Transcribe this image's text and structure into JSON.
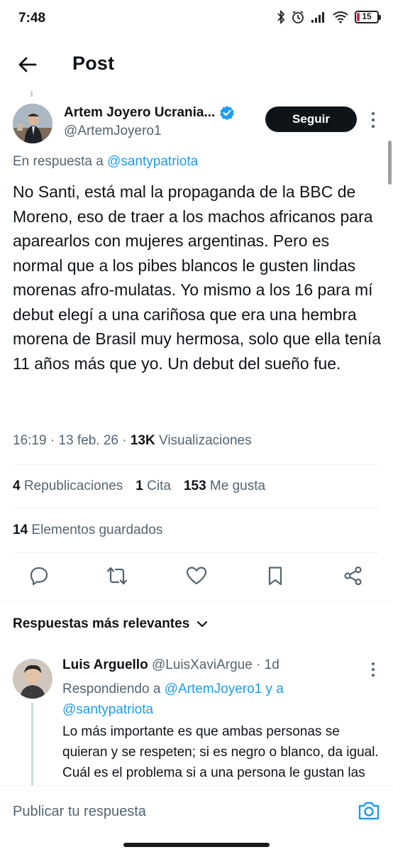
{
  "status_bar": {
    "time": "7:48",
    "battery": "15",
    "battery_level": 0.15,
    "battery_color": "#e0245e"
  },
  "header": {
    "title": "Post"
  },
  "post": {
    "author_name": "Artem Joyero Ucrania...",
    "author_handle": "@ArtemJoyero1",
    "follow_label": "Seguir",
    "reply_to_prefix": "En respuesta a",
    "reply_to_handle": "@santypatriota",
    "text": "No Santi, está mal la propaganda de la BBC de Moreno, eso de traer a los machos africanos para aparearlos con mujeres argentinas. Pero es normal que a los pibes blancos le gusten lindas morenas afro-mulatas. Yo mismo a los 16 para mí debut elegí a una cariñosa que era una hembra morena de Brasil muy hermosa, solo que ella tenía 11 años más que yo. Un debut del sueño fue.",
    "time": "16:19 · 13 feb. 26 · ",
    "views_count": "13K",
    "views_label": "Visualizaciones",
    "reposts_count": "4",
    "reposts_label": "Republicaciones",
    "quotes_count": "1",
    "quotes_label": "Cita",
    "likes_count": "153",
    "likes_label": "Me gusta",
    "bookmarks_count": "14",
    "bookmarks_label": "Elementos guardados"
  },
  "replies_section": {
    "title": "Respuestas más relevantes"
  },
  "reply": {
    "name": "Luis Arguello",
    "handle_time": "@LuisXaviArgue · 1d",
    "replying_prefix": "Respondiendo a",
    "replying_handles": "@ArtemJoyero1 y a @santypatriota",
    "text": "Lo más importante es que ambas personas se quieran y se respeten; si es negro o blanco, da igual. Cuál es el problema si a una persona le gustan las negras"
  },
  "composer": {
    "placeholder": "Publicar tu respuesta"
  },
  "colors": {
    "accent": "#1d9bf0",
    "text": "#0f1419",
    "secondary": "#536471",
    "verified": "#1d9bf0"
  }
}
